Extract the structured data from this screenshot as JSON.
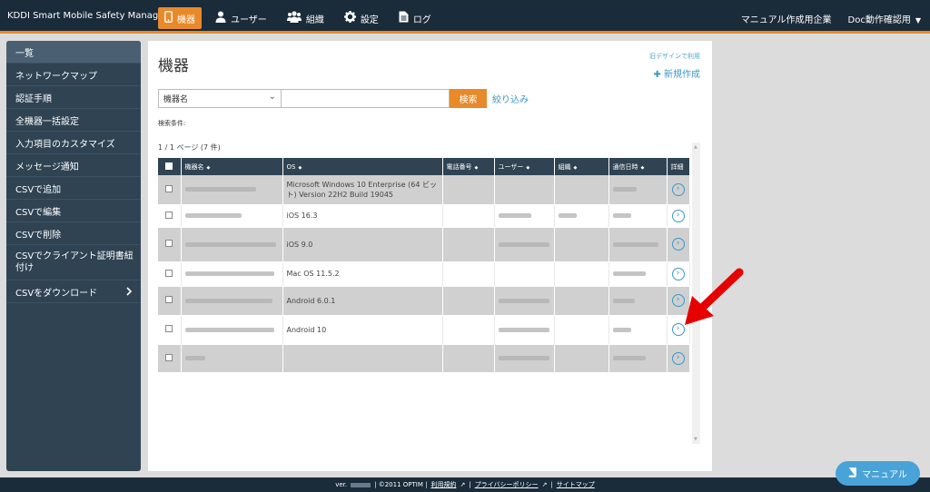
{
  "brand": "KDDI Smart Mobile Safety Manager",
  "nav": [
    {
      "label": "機器",
      "icon": "smartphone-icon"
    },
    {
      "label": "ユーザー",
      "icon": "user-icon"
    },
    {
      "label": "組織",
      "icon": "group-icon"
    },
    {
      "label": "設定",
      "icon": "gear-icon"
    },
    {
      "label": "ログ",
      "icon": "document-icon"
    }
  ],
  "header_right": {
    "company": "マニュアル作成用企業",
    "user": "Doc動作確認用"
  },
  "sidebar": [
    "一覧",
    "ネットワークマップ",
    "認証手順",
    "全機器一括設定",
    "入力項目のカスタマイズ",
    "メッセージ通知",
    "CSVで追加",
    "CSVで編集",
    "CSVで削除",
    "CSVでクライアント証明書紐付け",
    "CSVをダウンロード"
  ],
  "page": {
    "title": "機器",
    "old_design": "旧デザインで利用",
    "new": "新規作成",
    "search_select": "機器名",
    "search_button": "検索",
    "filter": "絞り込み",
    "conditions": "検索条件:",
    "pager": "1 / 1 ページ (7 件)"
  },
  "table": {
    "headers": [
      "機器名",
      "OS",
      "電話番号",
      "ユーザー",
      "組織",
      "通信日時",
      "詳細"
    ],
    "rows": [
      {
        "os": "Microsoft Windows 10 Enterprise (64 ビット) Version 22H2 Build 19045"
      },
      {
        "os": "iOS 16.3"
      },
      {
        "os": "iOS 9.0"
      },
      {
        "os": "Mac OS 11.5.2"
      },
      {
        "os": "Android 6.0.1"
      },
      {
        "os": "Android 10"
      },
      {
        "os": ""
      }
    ]
  },
  "footer": {
    "ver": "ver.",
    "copyright": "| ©2011 OPTIM |",
    "terms": "利用規約",
    "privacy": "プライバシーポリシー",
    "sitemap": "サイトマップ"
  },
  "manual_button": "マニュアル",
  "colors": {
    "accent": "#e8892a",
    "nav_bg": "#1a2b3a",
    "sidebar_bg": "#2f4352",
    "link": "#3a98c4"
  }
}
